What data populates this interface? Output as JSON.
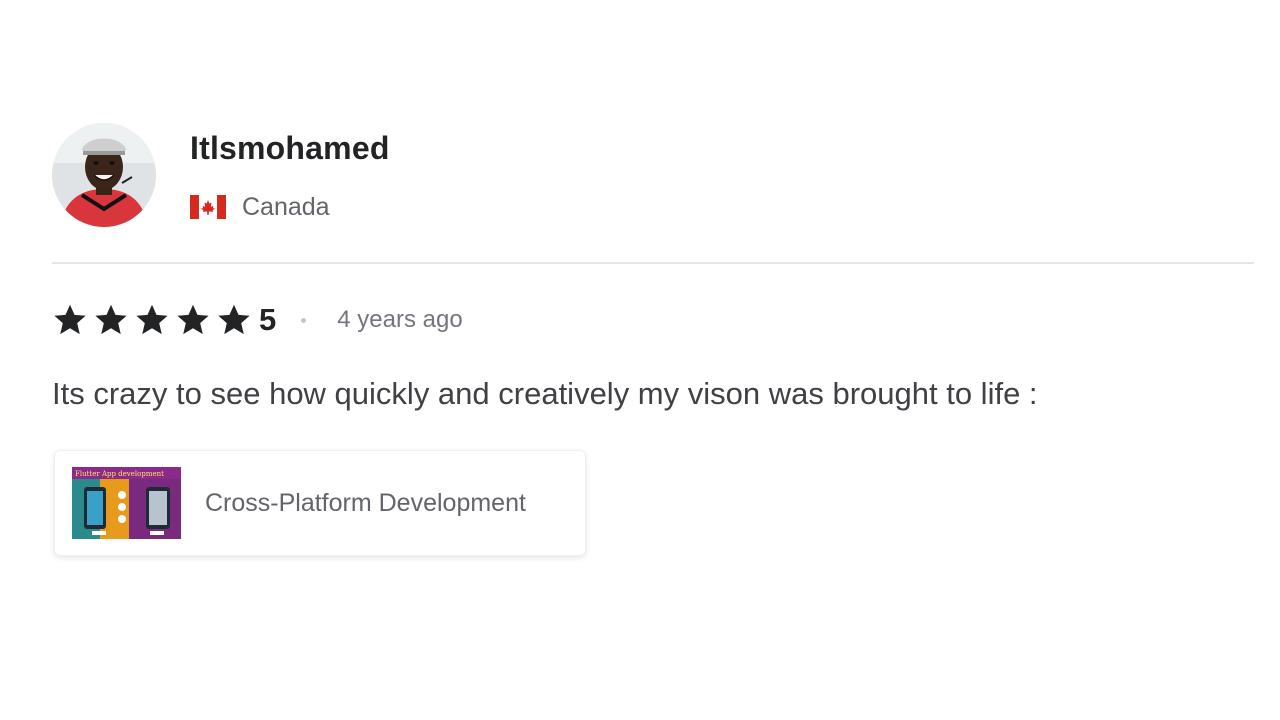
{
  "reviewer": {
    "username": "Itlsmohamed",
    "country": "Canada",
    "flag_icon": "canada-flag-icon",
    "avatar_icon": "user-avatar"
  },
  "rating": {
    "value": "5",
    "stars": 5,
    "time_ago": "4 years ago"
  },
  "review": {
    "text": "Its crazy to see how quickly and creatively my vison was brought to life :"
  },
  "gig": {
    "title": "Cross-Platform Development",
    "thumbnail_text": "Flutter App development"
  },
  "colors": {
    "star": "#222325",
    "flag_red": "#d52b1e",
    "divider": "#e4e5e7",
    "text_primary": "#222325",
    "text_secondary": "#62646a"
  }
}
